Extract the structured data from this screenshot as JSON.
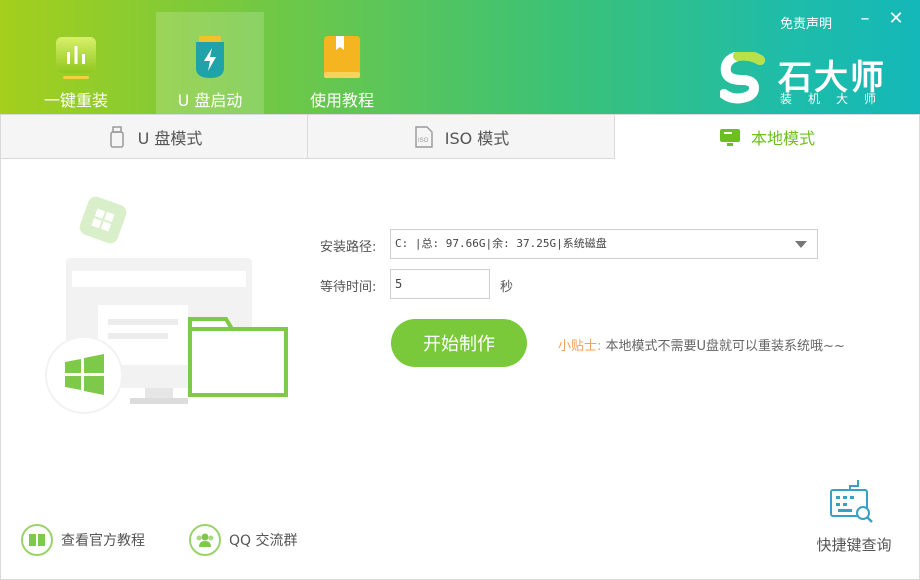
{
  "header": {
    "nav": [
      {
        "label": "一键重装",
        "icon": "chart-bar-icon"
      },
      {
        "label": "U 盘启动",
        "icon": "usb-drive-icon"
      },
      {
        "label": "使用教程",
        "icon": "tutorial-book-icon"
      }
    ],
    "disclaimer": "免责声明",
    "brand": {
      "title": "石大师",
      "subtitle": "装机大师"
    }
  },
  "tabs": [
    {
      "label": "U 盘模式",
      "icon": "usb-stick-icon",
      "active": false
    },
    {
      "label": "ISO 模式",
      "icon": "iso-file-icon",
      "active": false
    },
    {
      "label": "本地模式",
      "icon": "monitor-icon",
      "active": true
    }
  ],
  "form": {
    "install_path_label": "安装路径:",
    "install_path_value": "C: |总: 97.66G|余: 37.25G|系统磁盘",
    "wait_time_label": "等待时间:",
    "wait_time_value": "5",
    "wait_time_unit": "秒",
    "start_button": "开始制作",
    "tip_key": "小贴士:",
    "tip_text": "本地模式不需要U盘就可以重装系统哦~~"
  },
  "footer": {
    "official_tutorial": "查看官方教程",
    "qq_group": "QQ 交流群",
    "shortcut_query": "快捷键查询"
  },
  "colors": {
    "accent": "#79c93a",
    "active_tab_text": "#6cbf1f",
    "tip_key": "#f0a35a"
  }
}
